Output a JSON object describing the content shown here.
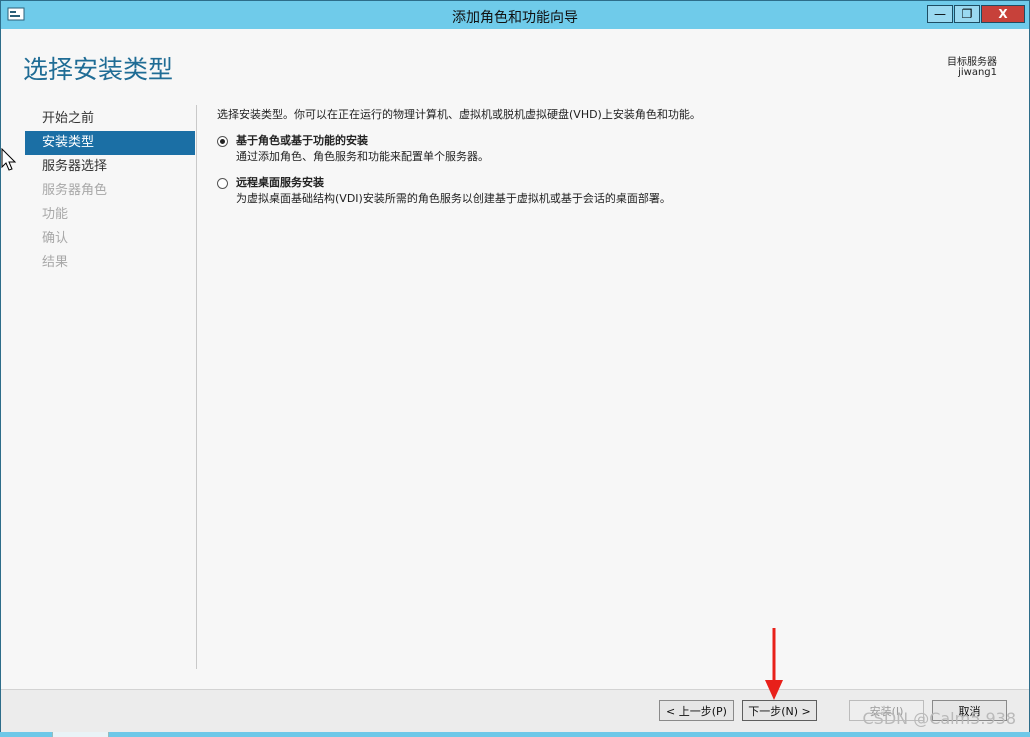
{
  "window": {
    "title": "添加角色和功能向导",
    "controls": {
      "minimize": "—",
      "maximize": "❐",
      "close": "X"
    }
  },
  "header": {
    "title": "选择安装类型",
    "destination_label": "目标服务器",
    "destination_server": "jiwang1"
  },
  "nav": {
    "items": [
      {
        "label": "开始之前",
        "state": "normal"
      },
      {
        "label": "安装类型",
        "state": "active"
      },
      {
        "label": "服务器选择",
        "state": "normal"
      },
      {
        "label": "服务器角色",
        "state": "disabled"
      },
      {
        "label": "功能",
        "state": "disabled"
      },
      {
        "label": "确认",
        "state": "disabled"
      },
      {
        "label": "结果",
        "state": "disabled"
      }
    ]
  },
  "content": {
    "intro": "选择安装类型。你可以在正在运行的物理计算机、虚拟机或脱机虚拟硬盘(VHD)上安装角色和功能。",
    "options": [
      {
        "title": "基于角色或基于功能的安装",
        "description": "通过添加角色、角色服务和功能来配置单个服务器。",
        "selected": true
      },
      {
        "title": "远程桌面服务安装",
        "description": "为虚拟桌面基础结构(VDI)安装所需的角色服务以创建基于虚拟机或基于会话的桌面部署。",
        "selected": false
      }
    ]
  },
  "footer": {
    "prev_label": "< 上一步(P)",
    "next_label": "下一步(N) >",
    "install_label": "安装(I)",
    "cancel_label": "取消"
  },
  "overlay": {
    "watermark": "CSDN @Calm5.938",
    "arrow_color": "#e8201a"
  }
}
